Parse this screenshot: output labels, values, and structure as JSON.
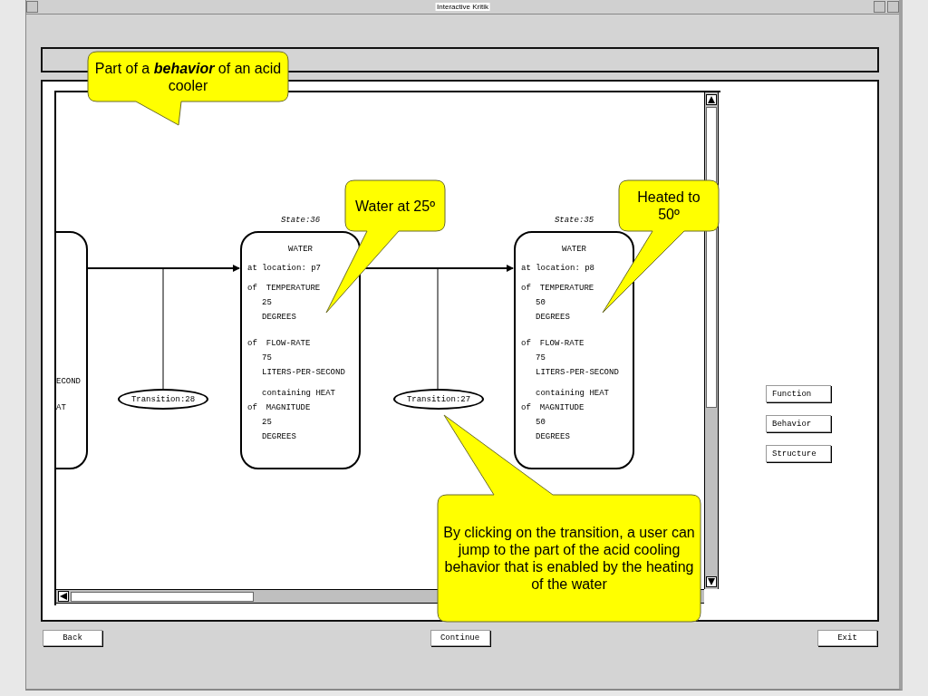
{
  "window": {
    "title": "Interactive Kritik"
  },
  "diagram": {
    "partial_state": {
      "lines": [
        "ECOND",
        "AT"
      ]
    },
    "states": [
      {
        "label": "State:36",
        "object": "WATER",
        "location": "at location: p7",
        "properties": [
          {
            "prefix": "of",
            "name": "TEMPERATURE",
            "value": "25",
            "unit": "DEGREES"
          },
          {
            "prefix": "of",
            "name": "FLOW-RATE",
            "value": "75",
            "unit": "LITERS-PER-SECOND"
          },
          {
            "container": "containing HEAT",
            "prefix": "of",
            "name": "MAGNITUDE",
            "value": "25",
            "unit": "DEGREES"
          }
        ]
      },
      {
        "label": "State:35",
        "object": "WATER",
        "location": "at location: p8",
        "properties": [
          {
            "prefix": "of",
            "name": "TEMPERATURE",
            "value": "50",
            "unit": "DEGREES"
          },
          {
            "prefix": "of",
            "name": "FLOW-RATE",
            "value": "75",
            "unit": "LITERS-PER-SECOND"
          },
          {
            "container": "containing HEAT",
            "prefix": "of",
            "name": "MAGNITUDE",
            "value": "50",
            "unit": "DEGREES"
          }
        ]
      }
    ],
    "transitions": [
      "Transition:28",
      "Transition:27"
    ]
  },
  "side_buttons": [
    "Function",
    "Behavior",
    "Structure"
  ],
  "bottom_buttons": [
    "Back",
    "Continue",
    "Exit"
  ],
  "callouts": [
    "Part of a **behavior** of an acid cooler",
    "Water at 25º",
    "Heated to 50º",
    "By clicking on the transition, a user can jump to the part of the acid cooling behavior that is enabled by the heating of the water"
  ]
}
